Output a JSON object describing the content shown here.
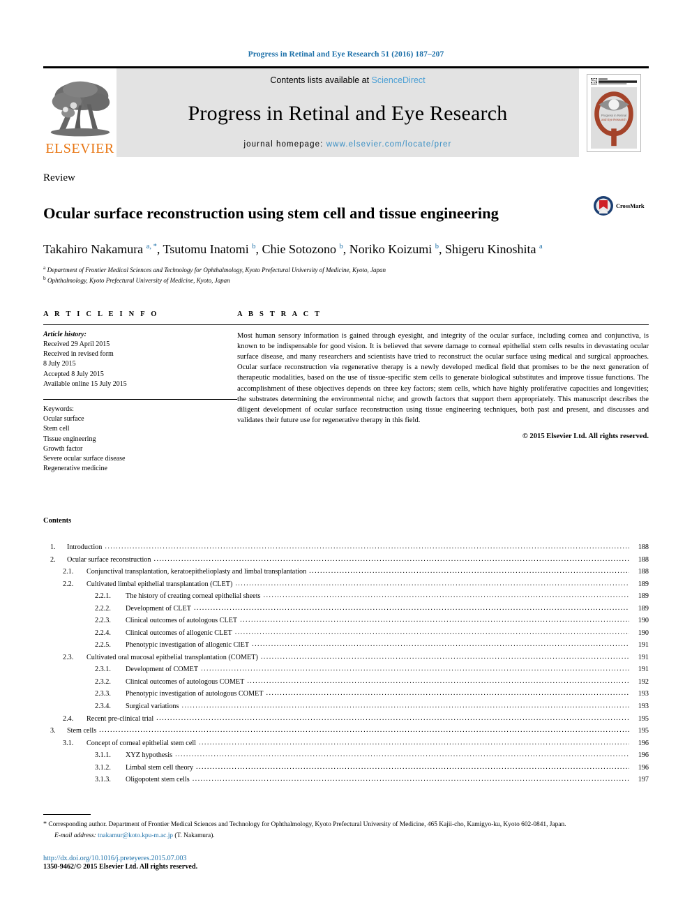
{
  "running_head": "Progress in Retinal and Eye Research 51 (2016) 187–207",
  "banner": {
    "contents_prefix": "Contents lists available at ",
    "sciencedirect": "ScienceDirect",
    "journal_title": "Progress in Retinal and Eye Research",
    "homepage_label": "journal homepage: ",
    "homepage_url": "www.elsevier.com/locate/prer",
    "publisher": "ELSEVIER",
    "cover_title": "RETINAL AND EYE RESEARCH",
    "cover_caption": "Progress in Retinal\nand Eye Research",
    "colors": {
      "banner_background": "#e3e3e3",
      "link_blue": "#4a9fd5",
      "elsevier_orange": "#e87511",
      "cover_eye": "#a4432a"
    }
  },
  "article": {
    "type": "Review",
    "title": "Ocular surface reconstruction using stem cell and tissue engineering",
    "crossmark_label": "CrossMark",
    "authors": [
      {
        "name": "Takahiro Nakamura",
        "marks": "a, *"
      },
      {
        "name": "Tsutomu Inatomi",
        "marks": "b"
      },
      {
        "name": "Chie Sotozono",
        "marks": "b"
      },
      {
        "name": "Noriko Koizumi",
        "marks": "b"
      },
      {
        "name": "Shigeru Kinoshita",
        "marks": "a"
      }
    ],
    "affiliations": [
      {
        "mark": "a",
        "text": "Department of Frontier Medical Sciences and Technology for Ophthalmology, Kyoto Prefectural University of Medicine, Kyoto, Japan"
      },
      {
        "mark": "b",
        "text": "Ophthalmology, Kyoto Prefectural University of Medicine, Kyoto, Japan"
      }
    ]
  },
  "article_info": {
    "heading": "A R T I C L E   I N F O",
    "history_label": "Article history:",
    "history": [
      "Received 29 April 2015",
      "Received in revised form",
      "8 July 2015",
      "Accepted 8 July 2015",
      "Available online 15 July 2015"
    ],
    "keywords_label": "Keywords:",
    "keywords": [
      "Ocular surface",
      "Stem cell",
      "Tissue engineering",
      "Growth factor",
      "Severe ocular surface disease",
      "Regenerative medicine"
    ]
  },
  "abstract": {
    "heading": "A B S T R A C T",
    "text": "Most human sensory information is gained through eyesight, and integrity of the ocular surface, including cornea and conjunctiva, is known to be indispensable for good vision. It is believed that severe damage to corneal epithelial stem cells results in devastating ocular surface disease, and many researchers and scientists have tried to reconstruct the ocular surface using medical and surgical approaches. Ocular surface reconstruction via regenerative therapy is a newly developed medical field that promises to be the next generation of therapeutic modalities, based on the use of tissue-specific stem cells to generate biological substitutes and improve tissue functions. The accomplishment of these objectives depends on three key factors; stem cells, which have highly proliferative capacities and longevities; the substrates determining the environmental niche; and growth factors that support them appropriately. This manuscript describes the diligent development of ocular surface reconstruction using tissue engineering techniques, both past and present, and discusses and validates their future use for regenerative therapy in this field.",
    "copyright": "© 2015 Elsevier Ltd. All rights reserved."
  },
  "contents": {
    "heading": "Contents",
    "entries": [
      {
        "level": 1,
        "num": "1.",
        "label": "Introduction",
        "page": "188"
      },
      {
        "level": 1,
        "num": "2.",
        "label": "Ocular surface reconstruction",
        "page": "188"
      },
      {
        "level": 2,
        "num": "2.1.",
        "label": "Conjunctival transplantation, keratoepithelioplasty and limbal transplantation",
        "page": "188"
      },
      {
        "level": 2,
        "num": "2.2.",
        "label": "Cultivated limbal epithelial transplantation (CLET)",
        "page": "189"
      },
      {
        "level": 3,
        "num": "2.2.1.",
        "label": "The history of creating corneal epithelial sheets",
        "page": "189"
      },
      {
        "level": 3,
        "num": "2.2.2.",
        "label": "Development of CLET",
        "page": "189"
      },
      {
        "level": 3,
        "num": "2.2.3.",
        "label": "Clinical outcomes of autologous CLET",
        "page": "190"
      },
      {
        "level": 3,
        "num": "2.2.4.",
        "label": "Clinical outcomes of allogenic CLET",
        "page": "190"
      },
      {
        "level": 3,
        "num": "2.2.5.",
        "label": "Phenotypic investigation of allogenic CIET",
        "page": "191"
      },
      {
        "level": 2,
        "num": "2.3.",
        "label": "Cultivated oral mucosal epithelial transplantation (COMET)",
        "page": "191"
      },
      {
        "level": 3,
        "num": "2.3.1.",
        "label": "Development of COMET",
        "page": "191"
      },
      {
        "level": 3,
        "num": "2.3.2.",
        "label": "Clinical outcomes of autologous COMET",
        "page": "192"
      },
      {
        "level": 3,
        "num": "2.3.3.",
        "label": "Phenotypic investigation of autologous COMET",
        "page": "193"
      },
      {
        "level": 3,
        "num": "2.3.4.",
        "label": "Surgical variations",
        "page": "193"
      },
      {
        "level": 2,
        "num": "2.4.",
        "label": "Recent pre-clinical trial",
        "page": "195"
      },
      {
        "level": 1,
        "num": "3.",
        "label": "Stem cells",
        "page": "195"
      },
      {
        "level": 2,
        "num": "3.1.",
        "label": "Concept of corneal epithelial stem cell",
        "page": "196"
      },
      {
        "level": 3,
        "num": "3.1.1.",
        "label": "XYZ hypothesis",
        "page": "196"
      },
      {
        "level": 3,
        "num": "3.1.2.",
        "label": "Limbal stem cell theory",
        "page": "196"
      },
      {
        "level": 3,
        "num": "3.1.3.",
        "label": "Oligopotent stem cells",
        "page": "197"
      }
    ]
  },
  "footnotes": {
    "corresponding": "Corresponding author. Department of Frontier Medical Sciences and Technology for Ophthalmology, Kyoto Prefectural University of Medicine, 465 Kajii-cho, Kamigyo-ku, Kyoto 602-0841, Japan.",
    "email_label": "E-mail address:",
    "email": "tnakamur@koto.kpu-m.ac.jp",
    "email_suffix": "(T. Nakamura)."
  },
  "footer": {
    "doi": "http://dx.doi.org/10.1016/j.preteyeres.2015.07.003",
    "issn_line": "1350-9462/© 2015 Elsevier Ltd. All rights reserved."
  }
}
